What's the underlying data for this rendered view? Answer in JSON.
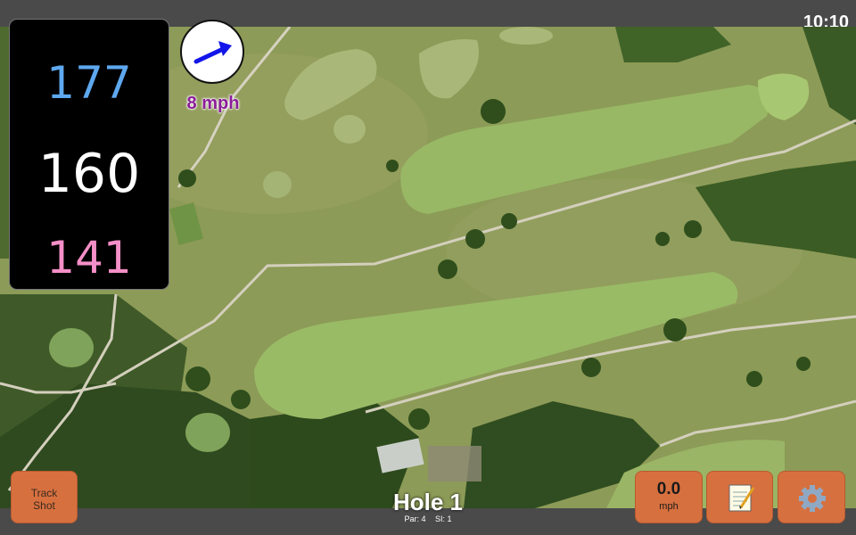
{
  "status_bar": {
    "time": "10:10"
  },
  "distances": {
    "back": "177",
    "middle": "160",
    "front": "141"
  },
  "wind": {
    "speed": "8 mph",
    "direction_icon": "arrow-up-right-icon"
  },
  "buttons": {
    "track_shot": [
      "Track",
      "Shot"
    ],
    "speed_value": "0.0",
    "speed_unit": "mph",
    "notes_icon": "notepad-icon",
    "settings_icon": "gear-icon"
  },
  "hole": {
    "title": "Hole 1",
    "par": "Par: 4",
    "si": "SI: 1"
  },
  "colors": {
    "back": "#5ea8ef",
    "front": "#f58fc7",
    "button": "#d7703f",
    "wind": "#8b1d9a"
  }
}
